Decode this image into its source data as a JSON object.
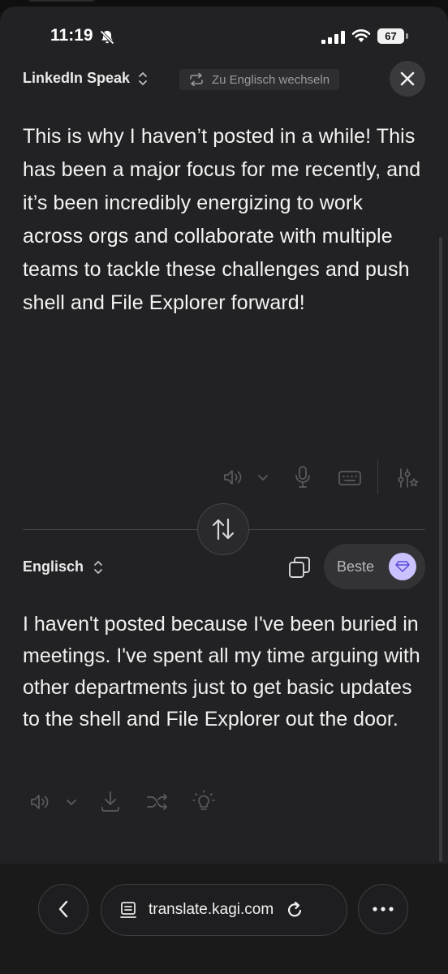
{
  "status_bar": {
    "time": "11:19",
    "battery": "67",
    "icons": [
      "bell-slash-icon",
      "cellular-signal-icon",
      "wifi-icon",
      "battery-icon"
    ]
  },
  "source": {
    "language": "LinkedIn Speak",
    "switch_label": "Zu Englisch wechseln",
    "text": "This is why I haven’t posted in a while! This has been a major focus for me recently, and it’s been incredibly energizing to work across orgs and collaborate with multiple teams to tackle these challenges and push shell and File Explorer forward!",
    "toolbar_icons": [
      "speaker-icon",
      "chevron-down-icon",
      "microphone-icon",
      "keyboard-icon",
      "settings-sliders-icon"
    ]
  },
  "target": {
    "language": "Englisch",
    "quality_label": "Beste",
    "text": "I haven't posted because I've been buried in meetings. I've spent all my time arguing with other departments just to get basic updates to the shell and File Explorer out the door.",
    "toolbar_icons": [
      "speaker-icon",
      "chevron-down-icon",
      "download-icon",
      "shuffle-icon",
      "lightbulb-icon"
    ]
  },
  "browser": {
    "url": "translate.kagi.com",
    "icons": [
      "back-icon",
      "page-icon",
      "reload-icon",
      "more-icon"
    ]
  },
  "colors": {
    "background": "#222224",
    "accent_gem": "#c9c2ff",
    "text": "#f4f4f4",
    "muted": "#9a9a9e"
  }
}
